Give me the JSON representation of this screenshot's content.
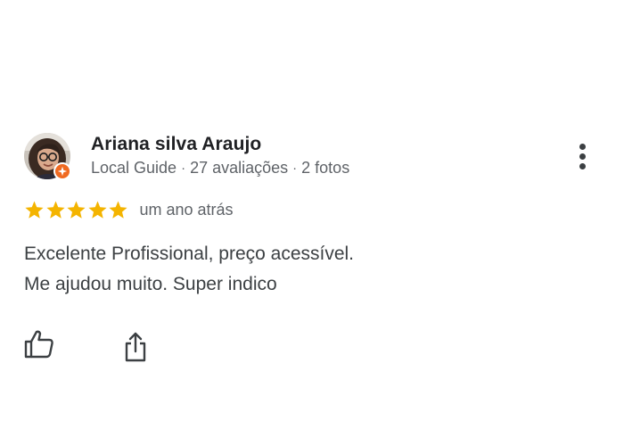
{
  "review": {
    "author": {
      "name": "Ariana silva Araujo",
      "badge": "Local Guide",
      "reviews_count": "27 avaliações",
      "photos_count": "2 fotos",
      "separator": "·",
      "avatar_icon": "user-avatar-photo",
      "badge_icon": "local-guide-badge-icon"
    },
    "rating": {
      "stars": 5,
      "max_stars": 5,
      "star_color": "#f4b400",
      "time_ago": "um ano atrás"
    },
    "text_lines": [
      "Excelente Profissional, preço acessível.",
      "Me ajudou muito. Super indico"
    ],
    "actions": {
      "more_icon": "more-vertical-icon",
      "like_icon": "thumbs-up-icon",
      "share_icon": "share-icon"
    },
    "colors": {
      "name": "#202124",
      "meta": "#5f6368",
      "text": "#3c4043",
      "badge": "#f06a21",
      "icons": "#3c4043"
    }
  }
}
